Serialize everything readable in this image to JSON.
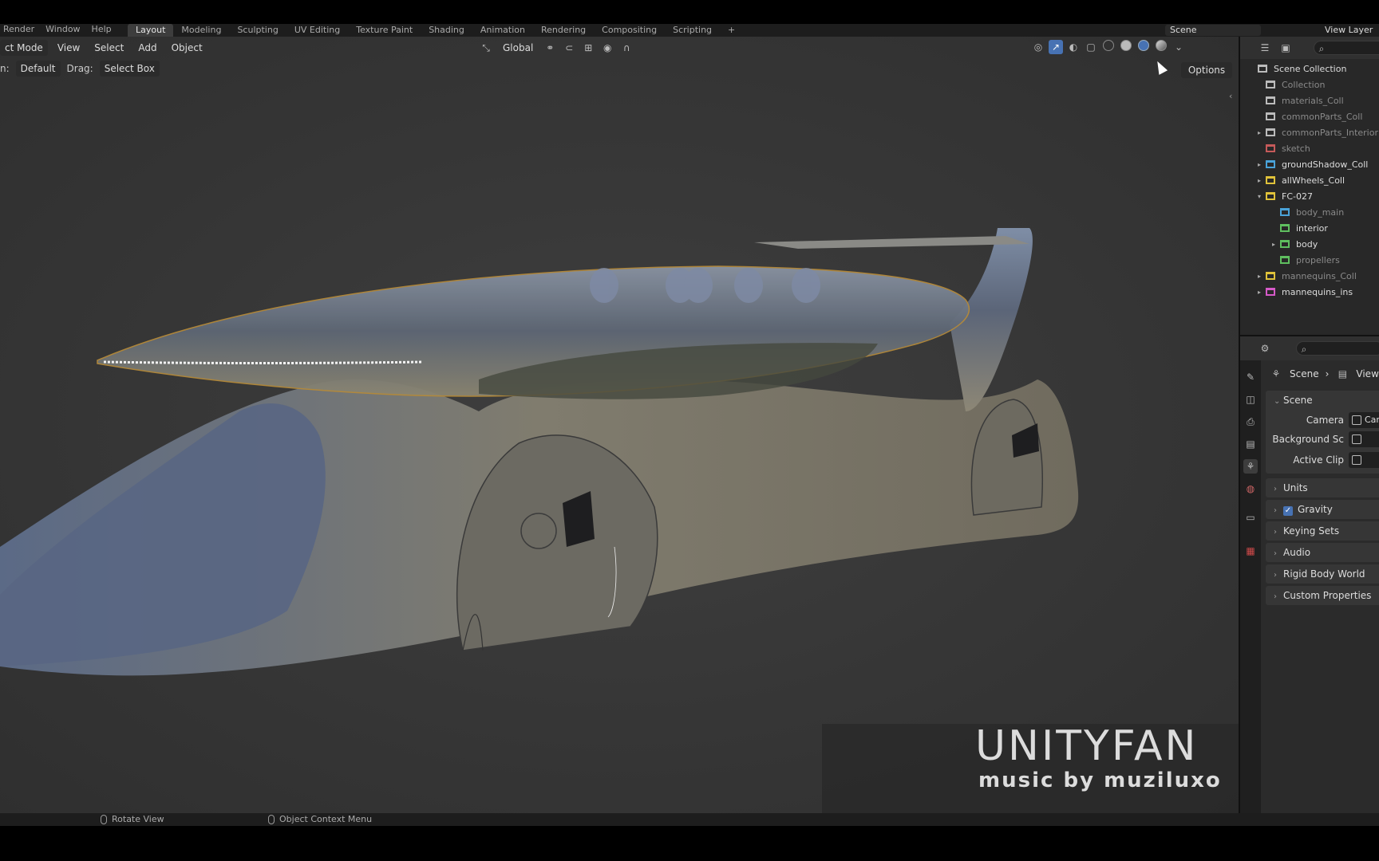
{
  "topbar": {
    "menus": [
      "Render",
      "Window",
      "Help"
    ],
    "workspaces": [
      "Layout",
      "Modeling",
      "Sculpting",
      "UV Editing",
      "Texture Paint",
      "Shading",
      "Animation",
      "Rendering",
      "Compositing",
      "Scripting",
      "+"
    ],
    "active_workspace": "Layout",
    "scene_name": "Scene",
    "view_layer": "View Layer"
  },
  "viewport": {
    "mode": "ct Mode",
    "menus": {
      "view": "View",
      "select": "Select",
      "add": "Add",
      "object": "Object"
    },
    "transform_orientation": "Global",
    "tool": {
      "orientation_label": "n:",
      "orientation_value": "Default",
      "drag_label": "Drag:",
      "drag_value": "Select Box"
    },
    "options": "Options"
  },
  "watermark": {
    "title": "UNITYFAN",
    "subtitle": "music by muziluxo"
  },
  "statusbar": {
    "left": "Rotate View",
    "right": "Object Context Menu"
  },
  "outliner": {
    "root": "Scene Collection",
    "items": [
      {
        "label": "Collection",
        "color": "#bbbbbb",
        "excluded": true,
        "expand": ""
      },
      {
        "label": "materials_Coll",
        "color": "#bbbbbb",
        "excluded": true,
        "expand": ""
      },
      {
        "label": "commonParts_Coll",
        "color": "#bbbbbb",
        "excluded": true,
        "expand": ""
      },
      {
        "label": "commonParts_Interior",
        "color": "#bbbbbb",
        "excluded": true,
        "expand": "▸"
      },
      {
        "label": "sketch",
        "color": "#c65a5a",
        "excluded": true,
        "expand": ""
      },
      {
        "label": "groundShadow_Coll",
        "color": "#4aa3d9",
        "excluded": false,
        "expand": "▸"
      },
      {
        "label": "allWheels_Coll",
        "color": "#e0c23a",
        "excluded": false,
        "expand": "▸"
      },
      {
        "label": "FC-027",
        "color": "#e0c23a",
        "excluded": false,
        "expand": "▾"
      },
      {
        "label": "body_main",
        "color": "#4aa3d9",
        "excluded": true,
        "expand": ""
      },
      {
        "label": "interior",
        "color": "#5fbf5f",
        "excluded": false,
        "expand": ""
      },
      {
        "label": "body",
        "color": "#5fbf5f",
        "excluded": false,
        "expand": "▸"
      },
      {
        "label": "propellers",
        "color": "#5fbf5f",
        "excluded": true,
        "expand": ""
      },
      {
        "label": "mannequins_Coll",
        "color": "#e0c23a",
        "excluded": true,
        "expand": "▸"
      },
      {
        "label": "mannequins_ins",
        "color": "#d65ac8",
        "excluded": false,
        "expand": "▸"
      }
    ]
  },
  "properties": {
    "breadcrumb": [
      "Scene",
      "View"
    ],
    "scene_panel": "Scene",
    "fields": [
      {
        "label": "Camera",
        "value": "Car"
      },
      {
        "label": "Background Sc",
        "value": ""
      },
      {
        "label": "Active Clip",
        "value": ""
      }
    ],
    "panels": [
      "Units",
      "Gravity",
      "Keying Sets",
      "Audio",
      "Rigid Body World",
      "Custom Properties"
    ],
    "gravity_checked": true
  },
  "colors": {
    "accent": "#4772b3",
    "panel": "#282828",
    "viewport": "#3a3a3a"
  }
}
